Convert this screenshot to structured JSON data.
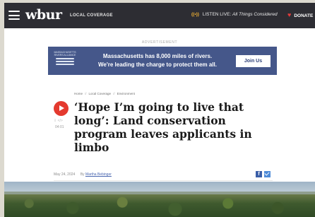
{
  "header": {
    "logo": "wbur",
    "section_label": "LOCAL COVERAGE",
    "live_label": "LISTEN LIVE:",
    "live_program": "All Things Considered",
    "donate_label": "DONATE"
  },
  "ad": {
    "label": "ADVERTISEMENT",
    "logo_text": "MASSACHUSETTS RIVERS ALLIANCE",
    "line1": "Massachusetts has 8,000 miles of rivers.",
    "line2": "We're leading the charge to protect them all.",
    "button": "Join Us"
  },
  "article": {
    "breadcrumbs": [
      "Home",
      "Local Coverage",
      "Environment"
    ],
    "duration": "04:01",
    "headline": "‘Hope I’m going to live that long’: Land conservation program leaves applicants in limbo",
    "date": "May 24, 2024",
    "by": "By",
    "author": "Martha Bebinger"
  },
  "colors": {
    "topbar": "#2d2d33",
    "accent_red": "#e43a2f",
    "ad_blue": "#45578a",
    "live_yellow": "#f2b234"
  }
}
